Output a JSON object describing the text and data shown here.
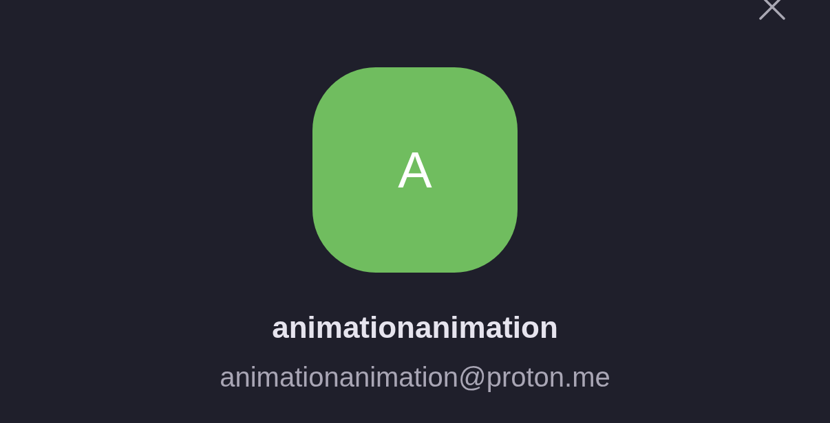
{
  "account": {
    "avatar_initial": "A",
    "name": "animationanimation",
    "email": "animationanimation@proton.me"
  }
}
